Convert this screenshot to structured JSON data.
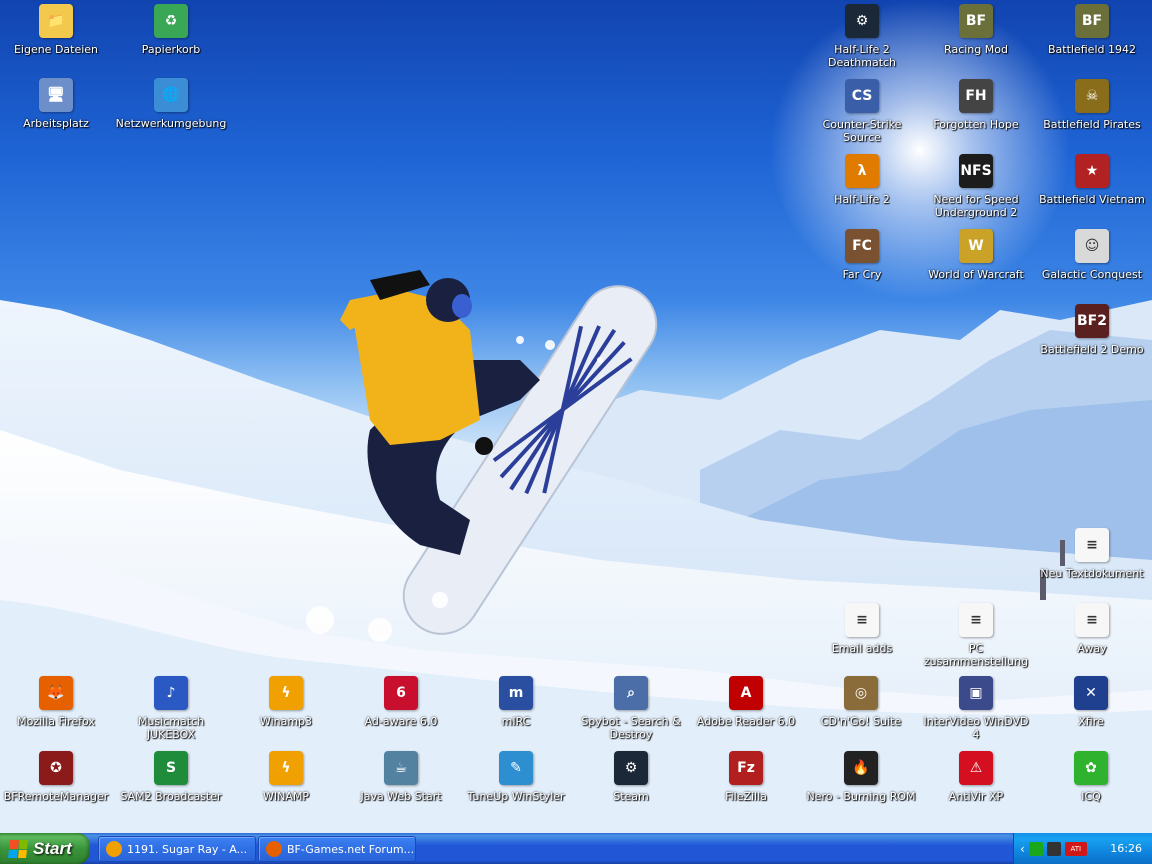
{
  "desktop": {
    "icons_left": [
      {
        "label": "Eigene Dateien",
        "icon": "folder-icon",
        "glyph": "📁",
        "color": "#f2c94c"
      },
      {
        "label": "Papierkorb",
        "icon": "recycle-bin-icon",
        "glyph": "♻",
        "color": "#3aa757"
      },
      {
        "label": "Arbeitsplatz",
        "icon": "computer-icon",
        "glyph": "🖥",
        "color": "#6d8fc9"
      },
      {
        "label": "Netzwerkumgebung",
        "icon": "network-icon",
        "glyph": "🌐",
        "color": "#3b8dd6"
      }
    ],
    "icons_right": [
      {
        "label": "Half-Life 2 Deathmatch",
        "icon": "steam-icon",
        "glyph": "⚙",
        "color": "#1b2838"
      },
      {
        "label": "Racing Mod",
        "icon": "battlefield-tank-icon",
        "glyph": "BF",
        "color": "#6b6f3a"
      },
      {
        "label": "Battlefield 1942",
        "icon": "battlefield-tank-icon",
        "glyph": "BF",
        "color": "#6b6f3a"
      },
      {
        "label": "Counter-Strike Source",
        "icon": "counter-strike-icon",
        "glyph": "CS",
        "color": "#3a5fa8"
      },
      {
        "label": "Forgotten Hope",
        "icon": "forgotten-hope-icon",
        "glyph": "FH",
        "color": "#444444"
      },
      {
        "label": "Battlefield Pirates",
        "icon": "pirates-icon",
        "glyph": "☠",
        "color": "#8a6d1a"
      },
      {
        "label": "Half-Life 2",
        "icon": "half-life-icon",
        "glyph": "λ",
        "color": "#e07b00"
      },
      {
        "label": "Need for Speed Underground 2",
        "icon": "nfs-icon",
        "glyph": "NFS",
        "color": "#1c1c1c"
      },
      {
        "label": "Battlefield Vietnam",
        "icon": "star-icon",
        "glyph": "★",
        "color": "#b22222"
      },
      {
        "label": "Far Cry",
        "icon": "far-cry-icon",
        "glyph": "FC",
        "color": "#7a5232"
      },
      {
        "label": "World of Warcraft",
        "icon": "wow-icon",
        "glyph": "W",
        "color": "#c9a227"
      },
      {
        "label": "Galactic Conquest",
        "icon": "stormtrooper-icon",
        "glyph": "☺",
        "color": "#d9d9d9"
      },
      {
        "label": "Battlefield 2 Demo",
        "icon": "battlefield-icon",
        "glyph": "BF2",
        "color": "#5a1f1f"
      }
    ],
    "icons_docs": [
      {
        "label": "Neu Textdokument",
        "icon": "text-document-icon",
        "glyph": "≡",
        "color": "#f7f7f7"
      },
      {
        "label": "Email adds",
        "icon": "text-document-icon",
        "glyph": "≡",
        "color": "#f7f7f7"
      },
      {
        "label": "PC zusammenstellung",
        "icon": "text-document-icon",
        "glyph": "≡",
        "color": "#f7f7f7"
      },
      {
        "label": "Away",
        "icon": "text-document-icon",
        "glyph": "≡",
        "color": "#f7f7f7"
      }
    ],
    "row1": [
      {
        "label": "Mozilla Firefox",
        "icon": "firefox-icon",
        "glyph": "🦊",
        "color": "#e66000"
      },
      {
        "label": "Musicmatch JUKEBOX",
        "icon": "musicmatch-icon",
        "glyph": "♪",
        "color": "#2b59c3"
      },
      {
        "label": "Winamp3",
        "icon": "winamp-icon",
        "glyph": "ϟ",
        "color": "#f0a000"
      },
      {
        "label": "Ad-aware 6.0",
        "icon": "ad-aware-icon",
        "glyph": "6",
        "color": "#c8102e"
      },
      {
        "label": "mIRC",
        "icon": "mirc-icon",
        "glyph": "m",
        "color": "#2a4fa0"
      },
      {
        "label": "Spybot - Search & Destroy",
        "icon": "spybot-icon",
        "glyph": "⌕",
        "color": "#4b6ea8"
      },
      {
        "label": "Adobe Reader 6.0",
        "icon": "adobe-reader-icon",
        "glyph": "A",
        "color": "#c00000"
      },
      {
        "label": "CD'n'Go! Suite",
        "icon": "cd-icon",
        "glyph": "◎",
        "color": "#8a6b3a"
      },
      {
        "label": "InterVideo WinDVD 4",
        "icon": "dvd-icon",
        "glyph": "▣",
        "color": "#3b4a8a"
      },
      {
        "label": "Xfire",
        "icon": "xfire-icon",
        "glyph": "✕",
        "color": "#1f3f8f"
      }
    ],
    "row2": [
      {
        "label": "BFRemoteManager",
        "icon": "bf-remote-icon",
        "glyph": "✪",
        "color": "#8b1a1a"
      },
      {
        "label": "SAM2 Broadcaster",
        "icon": "sam-icon",
        "glyph": "S",
        "color": "#1e8c3a"
      },
      {
        "label": "WINAMP",
        "icon": "winamp-icon",
        "glyph": "ϟ",
        "color": "#f0a000"
      },
      {
        "label": "Java Web Start",
        "icon": "java-icon",
        "glyph": "☕",
        "color": "#5382a1"
      },
      {
        "label": "TuneUp WinStyler",
        "icon": "tuneup-icon",
        "glyph": "✎",
        "color": "#2d8fd0"
      },
      {
        "label": "Steam",
        "icon": "steam-icon",
        "glyph": "⚙",
        "color": "#1b2838"
      },
      {
        "label": "FileZilla",
        "icon": "filezilla-icon",
        "glyph": "Fz",
        "color": "#b21f1f"
      },
      {
        "label": "Nero - Burning ROM",
        "icon": "nero-icon",
        "glyph": "🔥",
        "color": "#222222"
      },
      {
        "label": "AntiVir XP",
        "icon": "antivir-icon",
        "glyph": "⚠",
        "color": "#d40f1f"
      },
      {
        "label": "ICQ",
        "icon": "icq-icon",
        "glyph": "✿",
        "color": "#2fb32f"
      }
    ]
  },
  "taskbar": {
    "start_label": "Start",
    "tasks": [
      {
        "label": "1191. Sugar Ray - A...",
        "icon": "winamp-icon",
        "color": "#f0a000"
      },
      {
        "label": "BF-Games.net Forum...",
        "icon": "firefox-icon",
        "color": "#e66000"
      }
    ],
    "tray_icons": [
      "tray-expand-icon",
      "network-activity-icon",
      "volume-icon",
      "ati-icon"
    ],
    "tray_colors": [
      "#1aa81a",
      "#333333",
      "#d01818"
    ],
    "tray_ati": "ATI",
    "clock": "16:26"
  }
}
